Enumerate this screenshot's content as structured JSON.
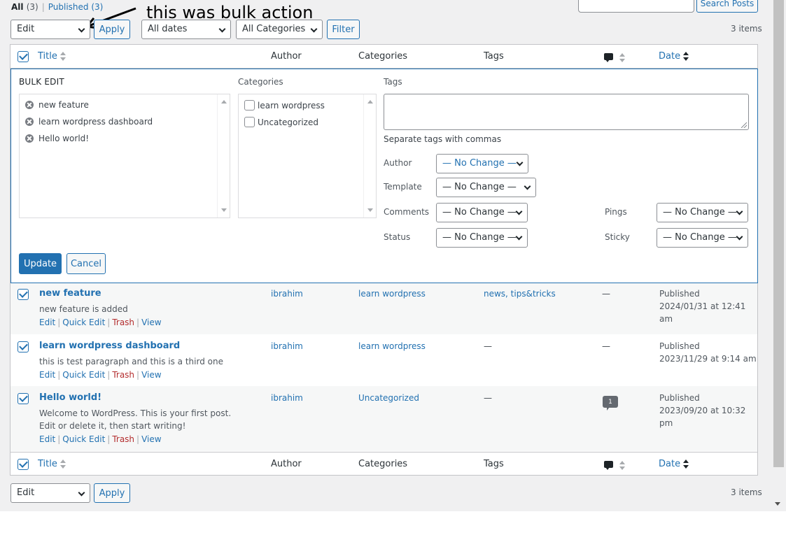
{
  "views": {
    "all_label": "All",
    "all_count": "(3)",
    "separator": "|",
    "published_label": "Published",
    "published_count": "(3)"
  },
  "annotation": "this was bulk action",
  "search": {
    "button_label": "Search Posts",
    "value": ""
  },
  "top_bar": {
    "bulk_action": "Edit",
    "apply_label": "Apply",
    "date_filter": "All dates",
    "category_filter": "All Categories",
    "filter_label": "Filter",
    "items_count": "3 items"
  },
  "columns": {
    "title": "Title",
    "author": "Author",
    "categories": "Categories",
    "tags": "Tags",
    "comments_icon": "comment-bubble-icon",
    "date": "Date"
  },
  "bulk_edit": {
    "heading": "BULK EDIT",
    "titles": [
      "new feature",
      "learn wordpress dashboard",
      "Hello world!"
    ],
    "categories_label": "Categories",
    "categories": [
      {
        "label": "learn wordpress",
        "checked": false
      },
      {
        "label": "Uncategorized",
        "checked": false
      }
    ],
    "tags_label": "Tags",
    "tags_help": "Separate tags with commas",
    "author_label": "Author",
    "author_value": "— No Change —",
    "template_label": "Template",
    "template_value": "— No Change —",
    "comments_label": "Comments",
    "comments_value": "— No Change —",
    "pings_label": "Pings",
    "pings_value": "— No Change —",
    "status_label": "Status",
    "status_value": "— No Change —",
    "sticky_label": "Sticky",
    "sticky_value": "— No Change —",
    "update_label": "Update",
    "cancel_label": "Cancel"
  },
  "row_actions": {
    "edit": "Edit",
    "quick_edit": "Quick Edit",
    "trash": "Trash",
    "view": "View",
    "sep": "|"
  },
  "posts": [
    {
      "title": "new feature",
      "excerpt": "new feature is added",
      "author": "ibrahim",
      "category": "learn wordpress",
      "tags": "news, tips&tricks",
      "comments": "—",
      "status": "Published",
      "date": "2024/01/31 at 12:41 am"
    },
    {
      "title": "learn wordpress dashboard",
      "excerpt": "this is test paragraph and this is a third one",
      "author": "ibrahim",
      "category": "learn wordpress",
      "tags": "—",
      "comments": "—",
      "status": "Published",
      "date": "2023/11/29 at 9:14 am"
    },
    {
      "title": "Hello world!",
      "excerpt": "Welcome to WordPress. This is your first post. Edit or delete it, then start writing!",
      "author": "ibrahim",
      "category": "Uncategorized",
      "tags": "—",
      "comments": "1",
      "status": "Published",
      "date": "2023/09/20 at 10:32 pm"
    }
  ],
  "bottom_bar": {
    "bulk_action": "Edit",
    "apply_label": "Apply",
    "items_count": "3 items"
  }
}
